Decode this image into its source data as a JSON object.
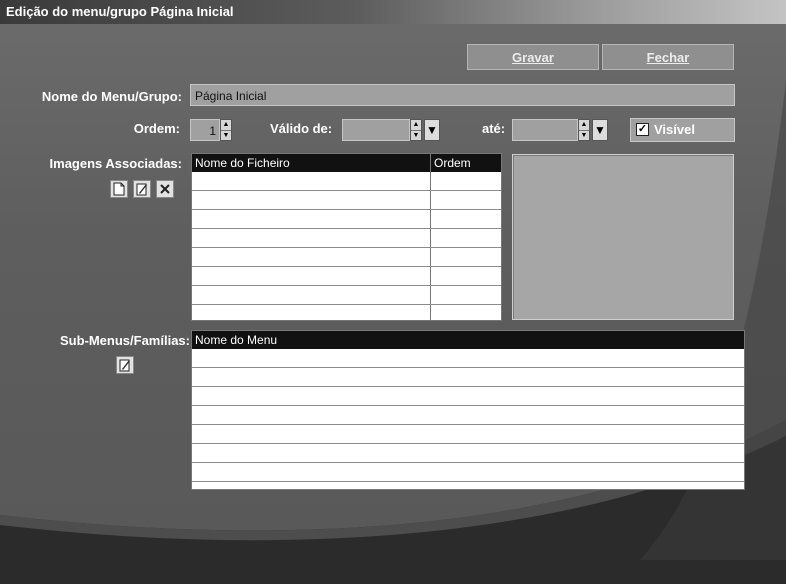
{
  "window": {
    "title": "Edição do menu/grupo Página Inicial"
  },
  "toolbar": {
    "save_label": "Gravar",
    "close_label": "Fechar"
  },
  "form": {
    "name_label": "Nome do Menu/Grupo:",
    "name_value": "Página Inicial",
    "order_label": "Ordem:",
    "order_value": "1",
    "valid_from_label": "Válido de:",
    "valid_from_value": "",
    "until_label": "até:",
    "until_value": "",
    "visible_label": "Visível",
    "visible_checked": true,
    "check_mark": "✓"
  },
  "images": {
    "label": "Imagens Associadas:",
    "columns": [
      "Nome do Ficheiro",
      "Ordem"
    ],
    "row_count": 8
  },
  "submenus": {
    "label": "Sub-Menus/Famílias:",
    "columns": [
      "Nome do Menu"
    ],
    "row_count": 7
  },
  "icons": {
    "new": "new-document-icon",
    "edit": "edit-pencil-icon",
    "delete": "delete-x-icon",
    "spin": "spin-updown-icon",
    "dropdown": "dropdown-arrow-icon"
  }
}
